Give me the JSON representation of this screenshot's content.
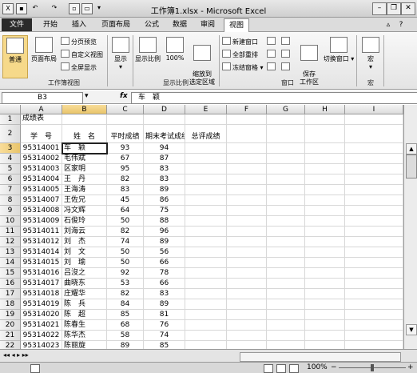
{
  "window": {
    "title": "工作簿1.xlsx - Microsoft Excel"
  },
  "tabs": [
    "文件",
    "开始",
    "插入",
    "页面布局",
    "公式",
    "数据",
    "审阅",
    "视图"
  ],
  "active_tab": "视图",
  "ribbon": {
    "workbook_views": {
      "group_label": "工作簿视图",
      "normal": "普通",
      "page_layout": "页面布局",
      "page_break": "分页预览",
      "custom_views": "自定义视图",
      "full_screen": "全屏显示"
    },
    "show": {
      "label": "显示"
    },
    "zoom": {
      "group_label": "显示比例",
      "zoom": "显示比例",
      "hundred": "100%",
      "zoom_to_selection": "缩放到\n选定区域"
    },
    "window": {
      "group_label": "窗口",
      "new_window": "新建窗口",
      "arrange_all": "全部重排",
      "freeze_panes": "冻结窗格",
      "save_workspace": "保存\n工作区",
      "switch_windows": "切换窗口"
    },
    "macros": {
      "group_label": "宏",
      "macros": "宏"
    }
  },
  "formula_bar": {
    "name_box": "B3",
    "fx": "fx",
    "content": "车　颖"
  },
  "columns": [
    "A",
    "B",
    "C",
    "D",
    "E",
    "F",
    "G",
    "H",
    "I"
  ],
  "rows": [
    {
      "n": "1",
      "a": "成绩表",
      "b": "",
      "c": "",
      "d": "",
      "e": ""
    },
    {
      "n": "2",
      "a": "学　号",
      "b": "姓　名",
      "c": "平时成绩",
      "d": "期末考试成绩",
      "e": "总评成绩"
    },
    {
      "n": "3",
      "a": "95314001",
      "b": "车　颖",
      "c": "93",
      "d": "94",
      "e": ""
    },
    {
      "n": "4",
      "a": "95314002",
      "b": "毛伟斌",
      "c": "67",
      "d": "87",
      "e": ""
    },
    {
      "n": "5",
      "a": "95314003",
      "b": "区家明",
      "c": "95",
      "d": "83",
      "e": ""
    },
    {
      "n": "6",
      "a": "95314004",
      "b": "王　丹",
      "c": "82",
      "d": "83",
      "e": ""
    },
    {
      "n": "7",
      "a": "95314005",
      "b": "王海涛",
      "c": "83",
      "d": "89",
      "e": ""
    },
    {
      "n": "8",
      "a": "95314007",
      "b": "王佐兄",
      "c": "45",
      "d": "86",
      "e": ""
    },
    {
      "n": "9",
      "a": "95314008",
      "b": "冯文辉",
      "c": "64",
      "d": "75",
      "e": ""
    },
    {
      "n": "10",
      "a": "95314009",
      "b": "石俊玲",
      "c": "50",
      "d": "88",
      "e": ""
    },
    {
      "n": "11",
      "a": "95314011",
      "b": "刘海云",
      "c": "82",
      "d": "96",
      "e": ""
    },
    {
      "n": "12",
      "a": "95314012",
      "b": "刘　杰",
      "c": "74",
      "d": "89",
      "e": ""
    },
    {
      "n": "13",
      "a": "95314014",
      "b": "刘　文",
      "c": "50",
      "d": "56",
      "e": ""
    },
    {
      "n": "14",
      "a": "95314015",
      "b": "刘　瑜",
      "c": "50",
      "d": "66",
      "e": ""
    },
    {
      "n": "15",
      "a": "95314016",
      "b": "吕沒之",
      "c": "92",
      "d": "78",
      "e": ""
    },
    {
      "n": "16",
      "a": "95314017",
      "b": "曲晓东",
      "c": "53",
      "d": "66",
      "e": ""
    },
    {
      "n": "17",
      "a": "95314018",
      "b": "庄耀华",
      "c": "82",
      "d": "83",
      "e": ""
    },
    {
      "n": "18",
      "a": "95314019",
      "b": "陈　兵",
      "c": "84",
      "d": "89",
      "e": ""
    },
    {
      "n": "19",
      "a": "95314020",
      "b": "陈　超",
      "c": "85",
      "d": "81",
      "e": ""
    },
    {
      "n": "20",
      "a": "95314021",
      "b": "陈春生",
      "c": "68",
      "d": "76",
      "e": ""
    },
    {
      "n": "21",
      "a": "95314022",
      "b": "陈华杰",
      "c": "58",
      "d": "74",
      "e": ""
    },
    {
      "n": "22",
      "a": "95314023",
      "b": "陈丽旋",
      "c": "89",
      "d": "85",
      "e": ""
    }
  ],
  "status": {
    "zoom": "100%"
  }
}
